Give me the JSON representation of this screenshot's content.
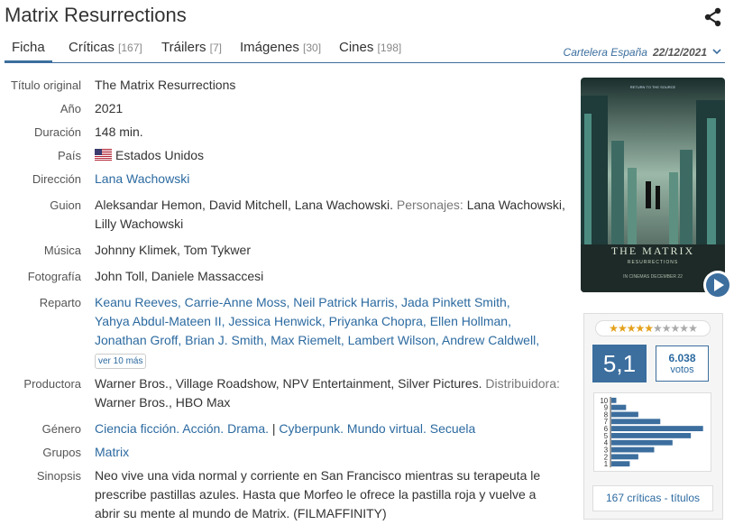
{
  "title": "Matrix Resurrections",
  "tabs": [
    {
      "label": "Ficha",
      "count": ""
    },
    {
      "label": "Críticas",
      "count": "[167]"
    },
    {
      "label": "Tráilers",
      "count": "[7]"
    },
    {
      "label": "Imágenes",
      "count": "[30]"
    },
    {
      "label": "Cines",
      "count": "[198]"
    }
  ],
  "cartelera": {
    "label": "Cartelera España",
    "date": "22/12/2021"
  },
  "details": {
    "titulo_original": {
      "label": "Título original",
      "value": "The Matrix Resurrections"
    },
    "anio": {
      "label": "Año",
      "value": "2021"
    },
    "duracion": {
      "label": "Duración",
      "value": "148 min."
    },
    "pais": {
      "label": "País",
      "value": "Estados Unidos"
    },
    "direccion": {
      "label": "Dirección",
      "value": "Lana Wachowski"
    },
    "guion": {
      "label": "Guion",
      "line1": "Aleksandar Hemon, David Mitchell, Lana Wachowski.",
      "personajes_label": "Personajes:",
      "line1b": "Lana Wachowski,",
      "line2": "Lilly Wachowski"
    },
    "musica": {
      "label": "Música",
      "value": "Johnny Klimek, Tom Tykwer"
    },
    "fotografia": {
      "label": "Fotografía",
      "value": "John Toll, Daniele Massaccesi"
    },
    "reparto": {
      "label": "Reparto",
      "actors": [
        "Keanu Reeves",
        "Carrie-Anne Moss",
        "Neil Patrick Harris",
        "Jada Pinkett Smith",
        "Yahya Abdul-Mateen II",
        "Jessica Henwick",
        "Priyanka Chopra",
        "Ellen Hollman",
        "Jonathan Groff",
        "Brian J. Smith",
        "Max Riemelt",
        "Lambert Wilson",
        "Andrew Caldwell"
      ],
      "more": "ver 10 más"
    },
    "productora": {
      "label": "Productora",
      "line1": "Warner Bros., Village Roadshow, NPV Entertainment, Silver Pictures.",
      "distribuidora_label": "Distribuidora:",
      "line2": "Warner Bros., HBO Max"
    },
    "genero": {
      "label": "Género",
      "genres": [
        "Ciencia ficción",
        "Acción",
        "Drama"
      ],
      "topics": [
        "Cyberpunk",
        "Mundo virtual",
        "Secuela"
      ]
    },
    "grupos": {
      "label": "Grupos",
      "value": "Matrix"
    },
    "sinopsis": {
      "label": "Sinopsis",
      "line1": "Neo vive una vida normal y corriente en San Francisco mientras su terapeuta le",
      "line2": "prescribe pastillas azules. Hasta que Morfeo le ofrece la pastilla roja y vuelve a",
      "line3": "abrir su mente al mundo de Matrix. (FILMAFFINITY)"
    }
  },
  "poster": {
    "top": "RETURN TO THE SOURCE",
    "brand": "THE MATRIX",
    "sub": "RESURRECTIONS",
    "release": "IN CINEMAS DECEMBER 22"
  },
  "rating": {
    "avg": "5,1",
    "votes": "6.038",
    "votes_label": "votos",
    "stars_on": 5,
    "stars_total": 10,
    "criticas_link": "167 críticas - títulos"
  },
  "chart_data": {
    "type": "bar",
    "orientation": "horizontal",
    "categories": [
      "10",
      "9",
      "8",
      "7",
      "6",
      "5",
      "4",
      "3",
      "2",
      "1"
    ],
    "values": [
      4,
      12,
      22,
      40,
      75,
      65,
      50,
      35,
      22,
      15
    ],
    "xlabel": "",
    "ylabel": ""
  },
  "colors": {
    "accent": "#3c6e9e",
    "link": "#2c6aa0",
    "star": "#e4a11b"
  }
}
